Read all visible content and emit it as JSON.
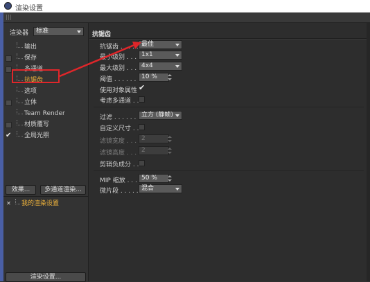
{
  "window": {
    "title": "渲染设置"
  },
  "left": {
    "renderer_label": "渲染器",
    "renderer_value": "标准",
    "tree": [
      {
        "label": "输出",
        "checked": false,
        "has_box": false
      },
      {
        "label": "保存",
        "checked": false,
        "has_box": true
      },
      {
        "label": "多通道",
        "checked": false,
        "has_box": true
      },
      {
        "label": "抗锯齿",
        "checked": false,
        "has_box": false,
        "active": true
      },
      {
        "label": "选项",
        "checked": false,
        "has_box": false
      },
      {
        "label": "立体",
        "checked": false,
        "has_box": true
      },
      {
        "label": "Team Render",
        "checked": false,
        "has_box": false
      },
      {
        "label": "材质覆写",
        "checked": false,
        "has_box": true
      },
      {
        "label": "全局光照",
        "checked": true,
        "has_box": false
      }
    ],
    "effects_button": "效果...",
    "multipass_button": "多通道渲染...",
    "settings_item": "我的渲染设置",
    "bottom_button": "渲染设置..."
  },
  "right": {
    "section_title": "抗锯齿",
    "antialias_label": "抗锯齿 . . . . .",
    "antialias_value": "最佳",
    "min_level_label": "最小级别 . . . .",
    "min_level_value": "1x1",
    "max_level_label": "最大级别 . . . .",
    "max_level_value": "4x4",
    "threshold_label": "阈值 . . . . . . .",
    "threshold_value": "10 %",
    "use_object_label": "使用对象属性",
    "consider_multipass_label": "考虑多通道 . . .",
    "filter_label": "过滤 . . . . . . .",
    "filter_value": "立方 (静帧)",
    "custom_size_label": "自定义尺寸 . . .",
    "filter_width_label": "滤镜宽度 . . . .",
    "filter_width_value": "2",
    "filter_height_label": "滤镜高度 . . . .",
    "filter_height_value": "2",
    "clip_negative_label": "剪辑负成分 . . .",
    "mip_label": "MIP 缩放 . . . .",
    "mip_value": "50 %",
    "micro_label": "微片段 . . . . . .",
    "micro_value": "混合"
  },
  "annotation": {
    "color": "#e0262a"
  }
}
